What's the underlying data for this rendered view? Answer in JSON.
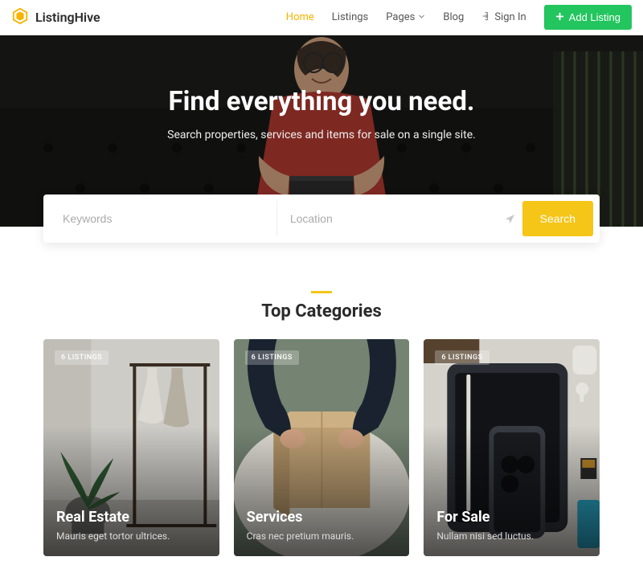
{
  "brand": {
    "name": "ListingHive"
  },
  "nav": {
    "home": "Home",
    "listings": "Listings",
    "pages": "Pages",
    "blog": "Blog",
    "signin": "Sign In",
    "add": "Add Listing"
  },
  "hero": {
    "title": "Find everything you need.",
    "subtitle": "Search properties, services and items for sale on a single site."
  },
  "search": {
    "keywords_ph": "Keywords",
    "location_ph": "Location",
    "button": "Search"
  },
  "categories": {
    "title": "Top Categories",
    "items": [
      {
        "badge": "6 LISTINGS",
        "name": "Real Estate",
        "desc": "Mauris eget tortor ultrices."
      },
      {
        "badge": "6 LISTINGS",
        "name": "Services",
        "desc": "Cras nec pretium mauris."
      },
      {
        "badge": "6 LISTINGS",
        "name": "For Sale",
        "desc": "Nullam nisi sed luctus."
      }
    ]
  }
}
